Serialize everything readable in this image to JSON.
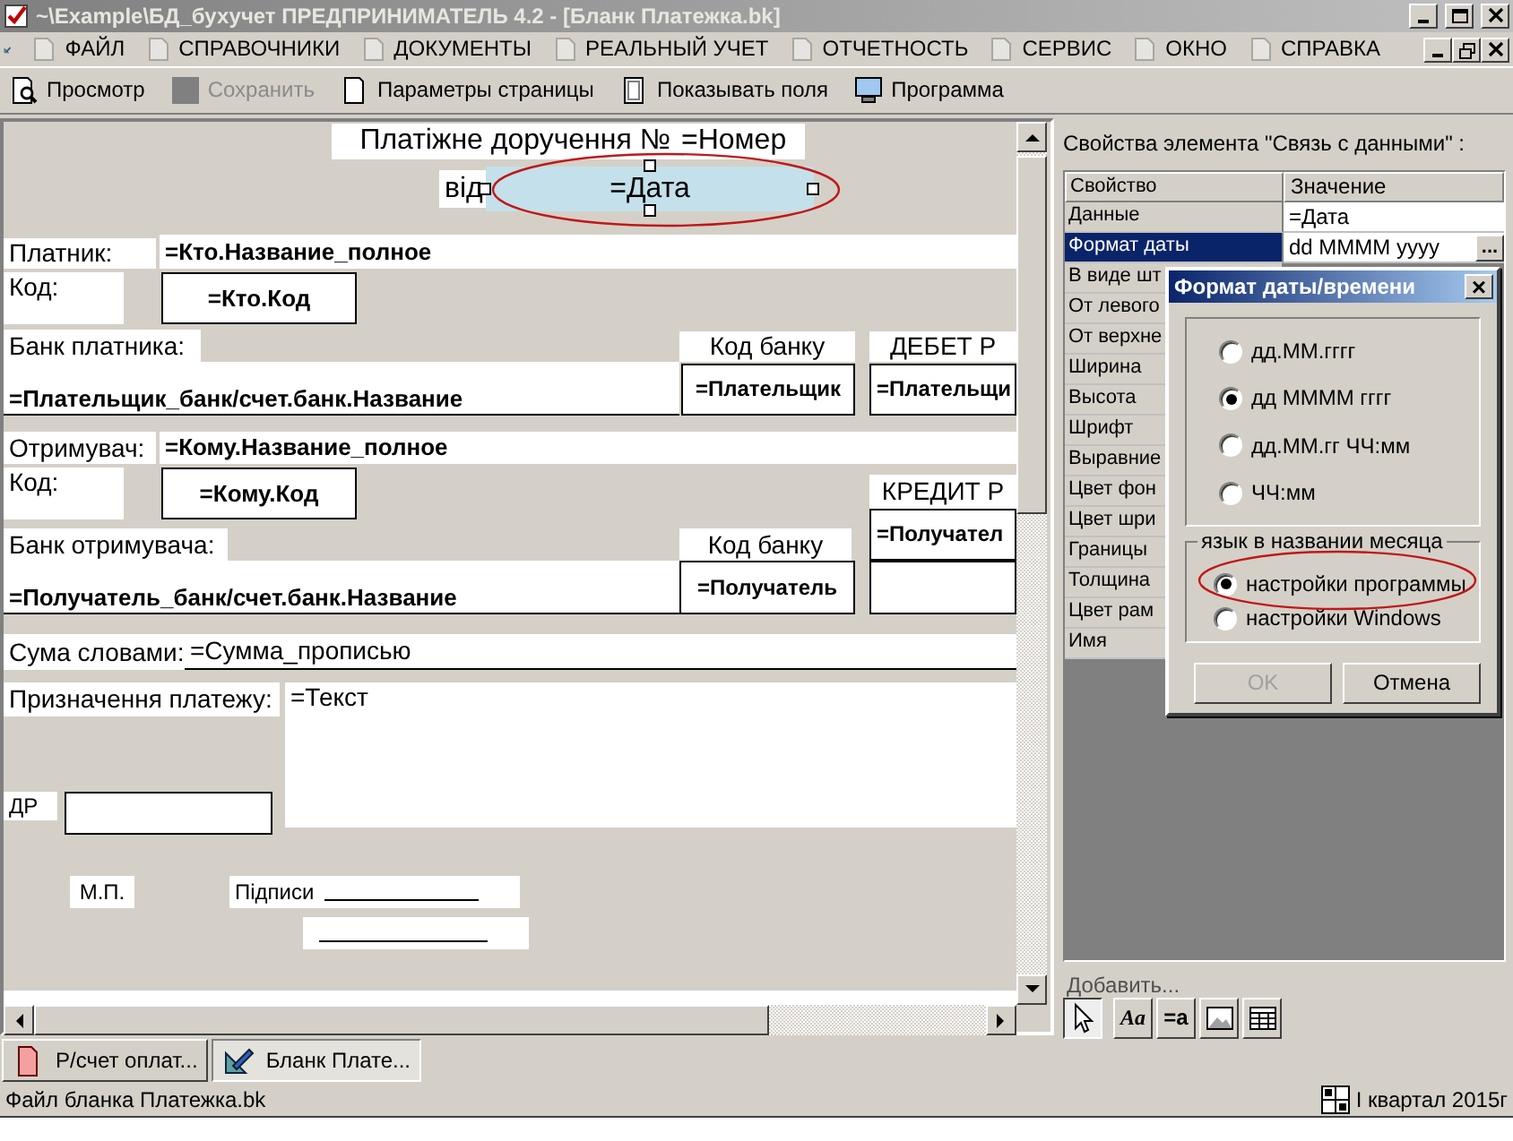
{
  "window": {
    "title": "~\\Example\\БД_бухучет  ПРЕДПРИНИМАТЕЛЬ 4.2 - [Бланк  Платежка.bk]"
  },
  "menu": [
    {
      "label": "ФАЙЛ"
    },
    {
      "label": "СПРАВОЧНИКИ"
    },
    {
      "label": "ДОКУМЕНТЫ"
    },
    {
      "label": "РЕАЛЬНЫЙ УЧЕТ"
    },
    {
      "label": "ОТЧЕТНОСТЬ"
    },
    {
      "label": "СЕРВИС"
    },
    {
      "label": "ОКНО"
    },
    {
      "label": "СПРАВКА"
    }
  ],
  "toolbar": [
    {
      "label": "Просмотр",
      "disabled": false
    },
    {
      "label": "Сохранить",
      "disabled": true
    },
    {
      "label": "Параметры страницы",
      "disabled": false
    },
    {
      "label": "Показывать поля",
      "disabled": false
    },
    {
      "label": "Программа",
      "disabled": false
    }
  ],
  "form": {
    "elements": [
      {
        "kind": "label",
        "text": "Платіжне доручення №",
        "selected": false,
        "circled": false
      },
      {
        "kind": "label",
        "text": "=Номер",
        "selected": false,
        "circled": false
      },
      {
        "kind": "label",
        "text": "від",
        "selected": false,
        "circled": false
      },
      {
        "kind": "label",
        "text": "=Дата",
        "selected": true,
        "circled": true
      },
      {
        "kind": "label",
        "text": "Платник:",
        "selected": false,
        "circled": false
      },
      {
        "kind": "value",
        "text": "=Кто.Название_полное",
        "selected": false,
        "circled": false
      },
      {
        "kind": "label",
        "text": "Код:",
        "selected": false,
        "circled": false
      },
      {
        "kind": "boxed",
        "text": "=Кто.Код",
        "selected": false,
        "circled": false
      },
      {
        "kind": "label",
        "text": "Банк платника:",
        "selected": false,
        "circled": false
      },
      {
        "kind": "underline",
        "text": "=Плательщик_банк/счет.банк.Название",
        "selected": false,
        "circled": false
      },
      {
        "kind": "label",
        "text": "Код банку",
        "selected": false,
        "circled": false
      },
      {
        "kind": "boxed",
        "text": "=Плательщик",
        "selected": false,
        "circled": false
      },
      {
        "kind": "label",
        "text": "ДЕБЕТ Р",
        "selected": false,
        "circled": false
      },
      {
        "kind": "boxed",
        "text": "=Плательщи",
        "selected": false,
        "circled": false
      },
      {
        "kind": "label",
        "text": "Отримувач:",
        "selected": false,
        "circled": false
      },
      {
        "kind": "value",
        "text": "=Кому.Название_полное",
        "selected": false,
        "circled": false
      },
      {
        "kind": "label",
        "text": "Код:",
        "selected": false,
        "circled": false
      },
      {
        "kind": "boxed",
        "text": "=Кому.Код",
        "selected": false,
        "circled": false
      },
      {
        "kind": "label",
        "text": "КРЕДИТ Р",
        "selected": false,
        "circled": false
      },
      {
        "kind": "boxed",
        "text": "=Получател",
        "selected": false,
        "circled": false
      },
      {
        "kind": "box",
        "selected": false,
        "circled": false
      },
      {
        "kind": "label",
        "text": "Банк отримувача:",
        "selected": false,
        "circled": false
      },
      {
        "kind": "underline",
        "text": "=Получатель_банк/счет.банк.Название",
        "selected": false,
        "circled": false
      },
      {
        "kind": "label",
        "text": "Код банку",
        "selected": false,
        "circled": false
      },
      {
        "kind": "boxed",
        "text": "=Получатель",
        "selected": false,
        "circled": false
      },
      {
        "kind": "label",
        "text": "Сума словами:",
        "selected": false,
        "circled": false
      },
      {
        "kind": "line",
        "text": "=Сумма_прописью",
        "selected": false,
        "circled": false
      },
      {
        "kind": "label",
        "text": "Призначення платежу:",
        "selected": false,
        "circled": false
      },
      {
        "kind": "area",
        "text": "=Текст",
        "selected": false,
        "circled": false
      },
      {
        "kind": "label",
        "text": "ДР",
        "selected": false,
        "circled": false
      },
      {
        "kind": "box",
        "selected": false,
        "circled": false
      },
      {
        "kind": "label",
        "text": "М.П.",
        "selected": false,
        "circled": false
      },
      {
        "kind": "signature",
        "text": "Підписи",
        "selected": false,
        "circled": false
      },
      {
        "kind": "signature",
        "selected": false,
        "circled": false
      }
    ]
  },
  "properties": {
    "title": "Свойства элемента \"Связь с данными\" :",
    "columns": [
      "Свойство",
      "Значение"
    ],
    "rows": [
      {
        "name": "Данные",
        "value": "=Дата",
        "selected": false
      },
      {
        "name": "Формат даты",
        "value": "dd MMMM yyyy",
        "button": "...",
        "selected": true
      },
      {
        "name": "В виде шт",
        "selected": false
      },
      {
        "name": "От левого",
        "selected": false
      },
      {
        "name": "От верхне",
        "selected": false
      },
      {
        "name": "Ширина",
        "selected": false
      },
      {
        "name": "Высота",
        "selected": false
      },
      {
        "name": "Шрифт",
        "selected": false
      },
      {
        "name": "Выравние",
        "selected": false
      },
      {
        "name": "Цвет фон",
        "selected": false
      },
      {
        "name": "Цвет шри",
        "selected": false
      },
      {
        "name": "Границы",
        "selected": false
      },
      {
        "name": "Толщина",
        "selected": false
      },
      {
        "name": "Цвет рам",
        "selected": false
      },
      {
        "name": "Имя",
        "selected": false
      }
    ]
  },
  "dialog": {
    "title": "Формат даты/времени",
    "close": "×",
    "formats": [
      {
        "label": "дд.ММ.гггг",
        "selected": false
      },
      {
        "label": "дд ММММ гггг",
        "selected": true
      },
      {
        "label": "дд.ММ.гг  ЧЧ:мм",
        "selected": false
      },
      {
        "label": "ЧЧ:мм",
        "selected": false
      }
    ],
    "language_group": "язык в названии месяца",
    "languages": [
      {
        "label": "настройки программы",
        "selected": true,
        "circled": true
      },
      {
        "label": "настройки Windows",
        "selected": false,
        "circled": false
      }
    ],
    "buttons": [
      {
        "label": "OK",
        "disabled": true
      },
      {
        "label": "Отмена",
        "disabled": false
      }
    ]
  },
  "add_label": "Добавить...",
  "tools": [
    {
      "kind": "pointer",
      "selected": true
    },
    {
      "kind": "text",
      "label": "Aa",
      "selected": false
    },
    {
      "kind": "field",
      "label": "=a",
      "selected": false
    },
    {
      "kind": "image",
      "selected": false
    },
    {
      "kind": "table",
      "selected": false
    }
  ],
  "tabs": [
    {
      "label": "Р/счет оплат...",
      "selected": false
    },
    {
      "label": "Бланк  Плате...",
      "selected": true
    }
  ],
  "status": {
    "file": "Файл бланка  Платежка.bk",
    "period": "I квартал 2015г"
  }
}
